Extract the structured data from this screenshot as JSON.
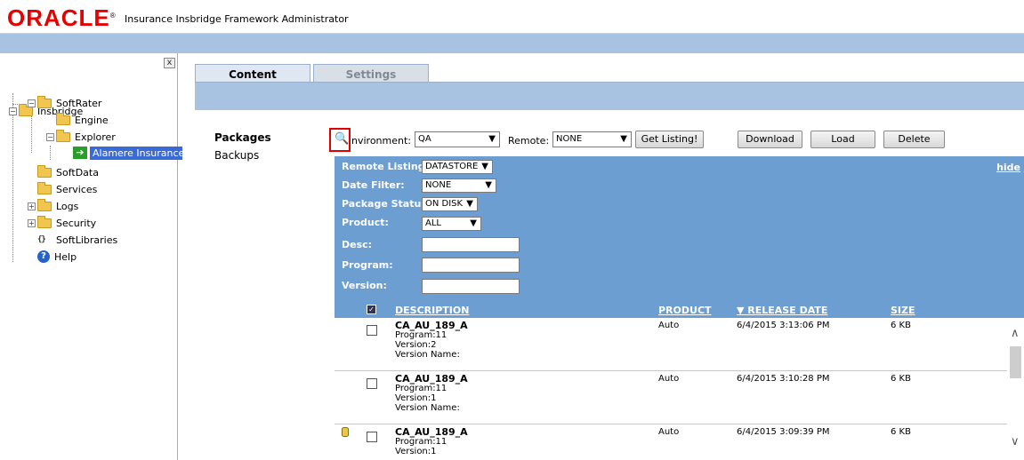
{
  "header": {
    "logo_text": "ORACLE",
    "logo_reg": "®",
    "app_title": "Insurance Insbridge Framework Administrator",
    "brand_color": "#e60000"
  },
  "sidebar": {
    "close_glyph": "x",
    "tree": {
      "root": "Insbridge",
      "softrater": "SoftRater",
      "engine": "Engine",
      "explorer": "Explorer",
      "alamere": "Alamere Insurance",
      "softdata": "SoftData",
      "services": "Services",
      "logs": "Logs",
      "security": "Security",
      "softlibraries": "SoftLibraries",
      "help": "Help"
    }
  },
  "tabs": {
    "content": "Content",
    "settings": "Settings"
  },
  "nav": {
    "packages": "Packages",
    "backups": "Backups"
  },
  "toolbar": {
    "environment_label": "nvironment:",
    "environment_value": "QA",
    "remote_label": "Remote:",
    "remote_value": "NONE",
    "get_listing": "Get Listing!",
    "download": "Download",
    "load": "Load",
    "delete": "Delete"
  },
  "filters": {
    "hide": "hide",
    "remote_listing_label": "Remote Listing:",
    "remote_listing_value": "DATASTORE",
    "date_filter_label": "Date Filter:",
    "date_filter_value": "NONE",
    "package_status_label": "Package Status:",
    "package_status_value": "ON DISK",
    "product_label": "Product:",
    "product_value": "ALL",
    "desc_label": "Desc:",
    "program_label": "Program:",
    "version_label": "Version:"
  },
  "table": {
    "headers": {
      "description": "DESCRIPTION",
      "product": "PRODUCT",
      "release_date": "▼ RELEASE DATE",
      "size": "SIZE"
    },
    "rows": [
      {
        "name": "CA_AU_189_A",
        "program": "Program:11",
        "version": "Version:2",
        "version_name": "Version Name:",
        "product": "Auto",
        "release_date": "6/4/2015 3:13:06 PM",
        "size": "6 KB"
      },
      {
        "name": "CA_AU_189_A",
        "program": "Program:11",
        "version": "Version:1",
        "version_name": "Version Name:",
        "product": "Auto",
        "release_date": "6/4/2015 3:10:28 PM",
        "size": "6 KB"
      },
      {
        "name": "CA_AU_189_A",
        "program": "Program:11",
        "version": "Version:1",
        "version_name": "",
        "product": "Auto",
        "release_date": "6/4/2015 3:09:39 PM",
        "size": "6 KB"
      }
    ]
  }
}
